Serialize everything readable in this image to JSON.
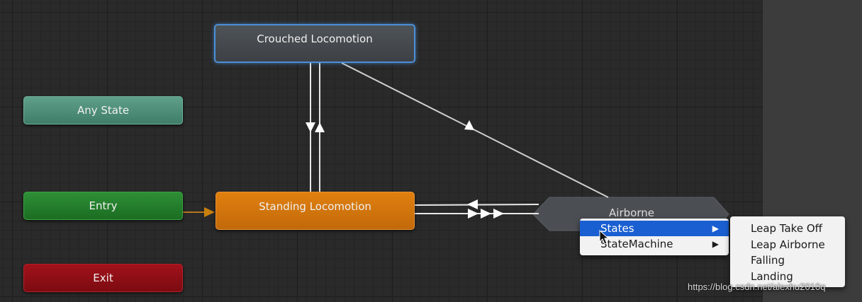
{
  "nodes": {
    "any_state": "Any State",
    "entry": "Entry",
    "exit": "Exit",
    "crouched_locomotion": "Crouched Locomotion",
    "standing_locomotion": "Standing Locomotion",
    "airborne": "Airborne"
  },
  "context_menu": {
    "items": [
      {
        "label": "States",
        "active": true
      },
      {
        "label": "StateMachine",
        "active": false
      }
    ],
    "submenu": [
      "Leap Take Off",
      "Leap Airborne",
      "Falling",
      "Landing"
    ]
  },
  "watermark": "https://blog.csdn.net/alexhu2010q",
  "colors": {
    "canvas_bg": "#2a2a2a",
    "any_state": "#4f907a",
    "entry": "#24802c",
    "exit": "#901017",
    "standing": "#d1750c",
    "crouched": "#464a4f",
    "selection_outline": "#4c8fd6",
    "menu_highlight": "#1a5fd1"
  }
}
